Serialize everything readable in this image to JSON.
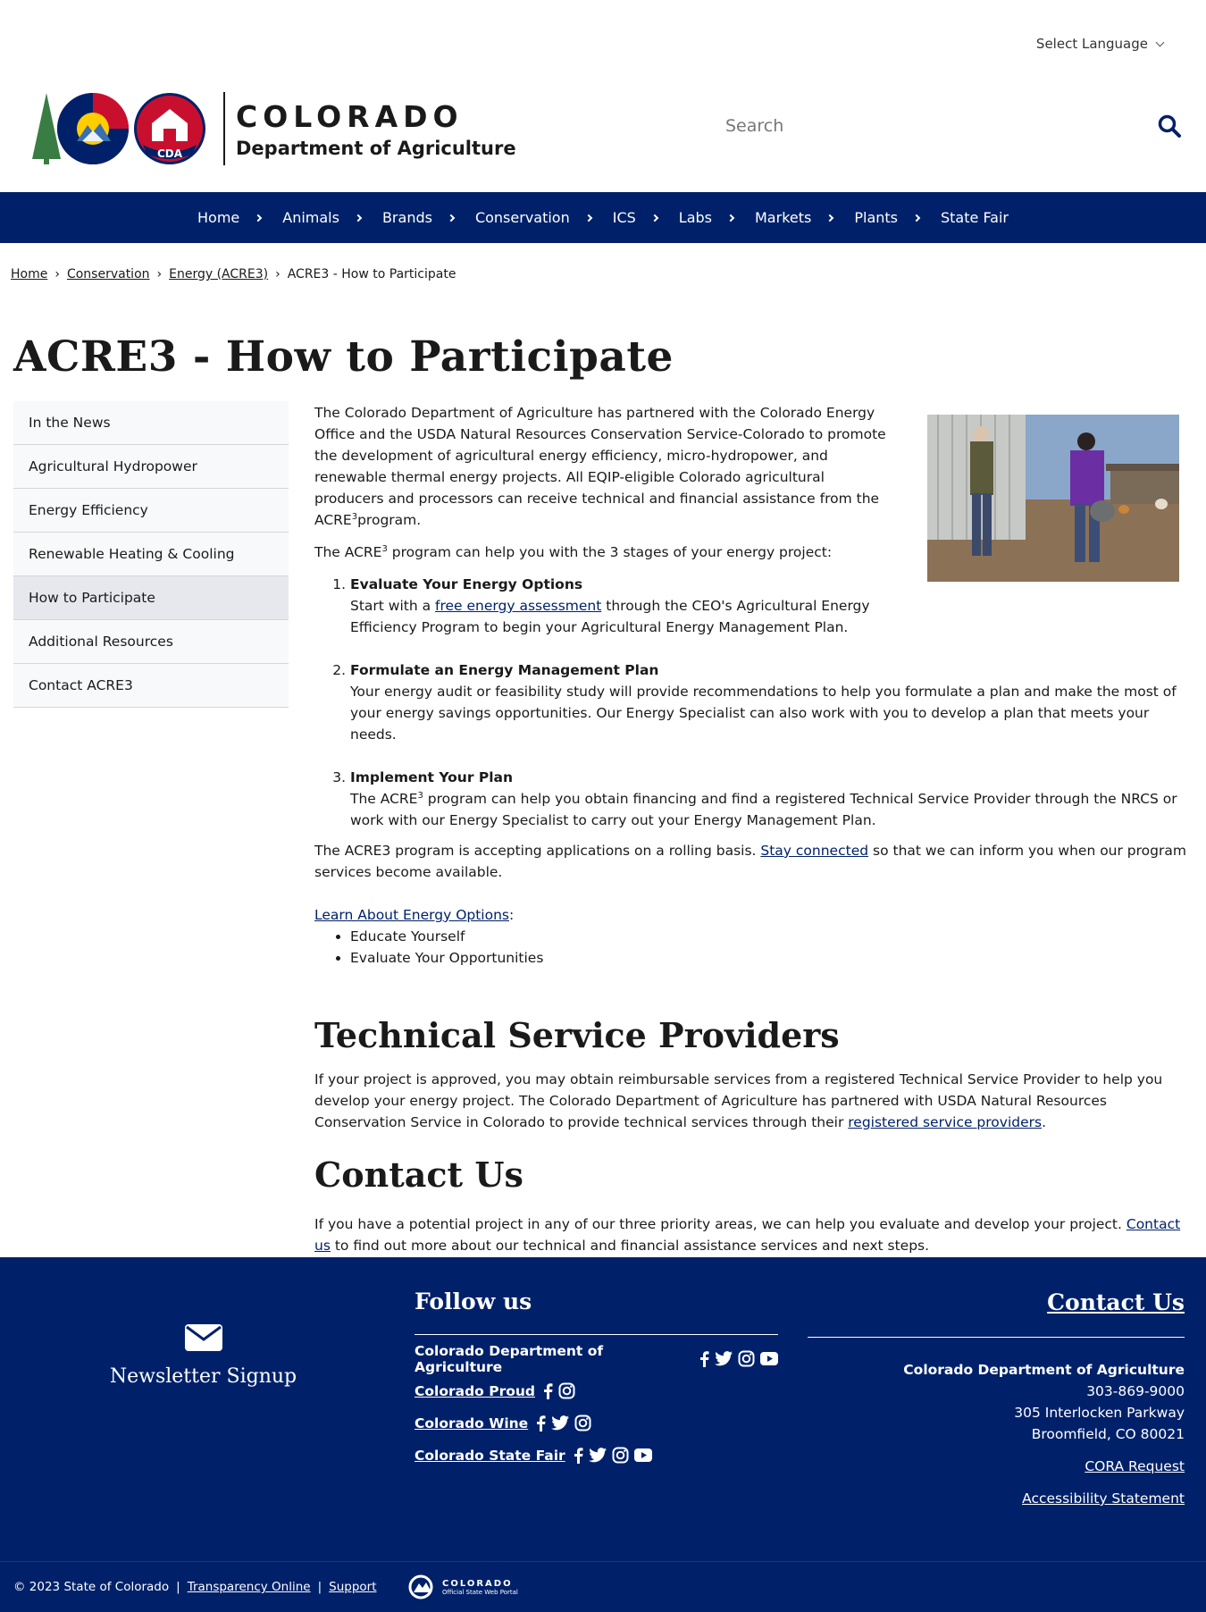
{
  "header": {
    "language_label": "Select Language",
    "logo_line1": "COLORADO",
    "logo_line2": "Department of Agriculture",
    "logo_badge": "CDA",
    "search_placeholder": "Search"
  },
  "nav": {
    "items": [
      "Home",
      "Animals",
      "Brands",
      "Conservation",
      "ICS",
      "Labs",
      "Markets",
      "Plants",
      "State Fair"
    ]
  },
  "breadcrumb": {
    "items": [
      "Home",
      "Conservation",
      "Energy (ACRE3)"
    ],
    "current": "ACRE3 - How to Participate"
  },
  "page_title": "ACRE3 - How to Participate",
  "sidebar": {
    "items": [
      "In the News",
      "Agricultural Hydropower",
      "Energy Efficiency",
      "Renewable Heating & Cooling",
      "How to Participate",
      "Additional Resources",
      "Contact ACRE3"
    ],
    "active": "How to Participate"
  },
  "content": {
    "intro_text": "The Colorado Department of Agriculture has partnered with the Colorado Energy Office and the USDA Natural Resources Conservation Service-Colorado to promote the development of agricultural energy efficiency, micro-hydropower, and renewable thermal energy projects. All EQIP-eligible Colorado agricultural producers and processors can receive technical and financial assistance from the ACRE",
    "intro_sup": "3",
    "intro_end": "program.",
    "stages_pre": "The ACRE",
    "stages_sup": "3",
    "stages_post": " program can help you with the 3 stages of your energy project:",
    "step1_title": "Evaluate Your Energy Options",
    "step1_pre": "Start with a ",
    "step1_link": "free energy assessment",
    "step1_post": " through the CEO's Agricultural Energy Efficiency Program to begin your Agricultural Energy Management Plan.",
    "step2_title": "Formulate an Energy Management Plan",
    "step2_text": "Your energy audit or feasibility study will provide recommendations to help you formulate a plan and make the most of your energy savings opportunities. Our Energy Specialist can also work with you to develop a plan that meets your needs.",
    "step3_title": "Implement Your Plan",
    "step3_pre": "The ACRE",
    "step3_sup": "3",
    "step3_post": " program can help you obtain financing and find a registered Technical Service Provider through the NRCS or work with our Energy Specialist to carry out your Energy Management Plan.",
    "rolling_pre": "The ACRE3 program is accepting applications on a rolling basis. ",
    "rolling_link": "Stay connected",
    "rolling_post": " so that we can inform you when our program services become available.",
    "learn_link": "Learn About Energy Options",
    "learn_colon": ":",
    "learn_items": [
      "Educate Yourself",
      "Evaluate Your Opportunities"
    ],
    "tsp_heading": "Technical Service Providers",
    "tsp_pre": "If your project is approved, you may obtain reimbursable services from a registered Technical Service Provider to help you develop your energy project. The Colorado Department of Agriculture has partnered with USDA Natural Resources Conservation Service in Colorado to provide technical services through their ",
    "tsp_link": "registered service providers",
    "tsp_post": ".",
    "contact_heading": "Contact Us",
    "contact_pre": "If you have a potential project in any of our three priority areas, we can help you evaluate and develop your project. ",
    "contact_link": "Contact us",
    "contact_post": " to find out more about our technical and financial assistance services and next steps."
  },
  "footer": {
    "newsletter_label": "Newsletter Signup",
    "follow_heading": "Follow us",
    "follow_rows": [
      "Colorado Department of Agriculture",
      "Colorado Proud",
      "Colorado Wine",
      "Colorado State Fair"
    ],
    "contact_heading": "Contact Us",
    "org": "Colorado Department of Agriculture",
    "phone": "303-869-9000",
    "address1": "305 Interlocken Parkway",
    "address2": "Broomfield, CO 80021",
    "cora_link": "CORA Request",
    "accessibility_link": "Accessibility Statement",
    "copyright": "© 2023 State of Colorado",
    "separator": "|",
    "transparency_link": "Transparency Online",
    "support_link": "Support",
    "portal_line1": "COLORADO",
    "portal_line2": "Official State Web Portal"
  },
  "colors": {
    "brand_navy": "#002169",
    "colorado_red": "#c8102e",
    "colorado_gold": "#ffcd00",
    "colorado_green": "#3a7d44"
  },
  "icons": [
    "chevron-down-icon",
    "search-icon",
    "envelope-icon",
    "facebook-icon",
    "twitter-icon",
    "instagram-icon",
    "youtube-icon"
  ]
}
